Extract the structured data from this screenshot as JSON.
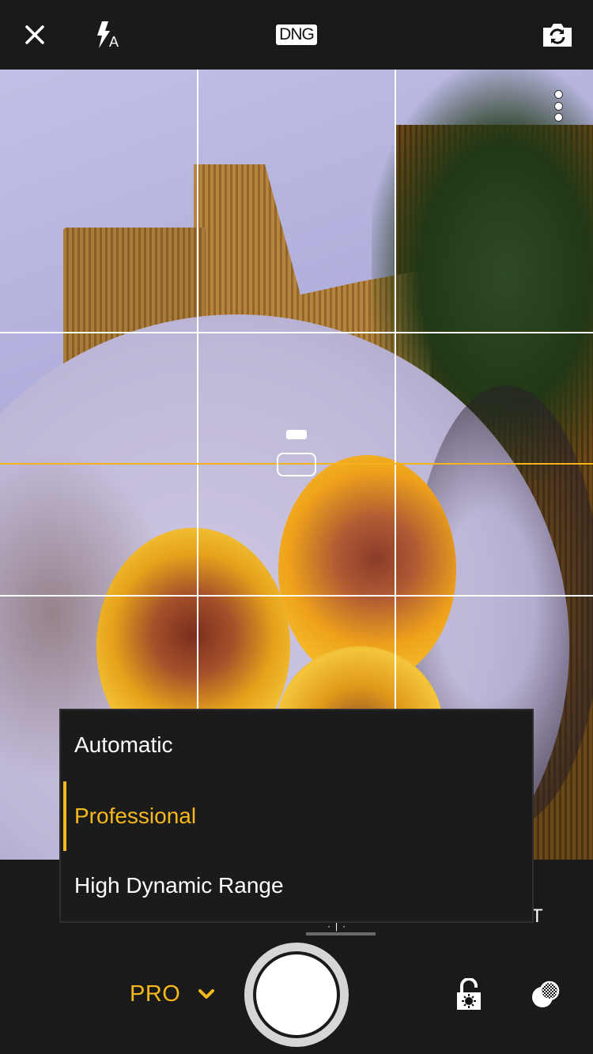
{
  "topbar": {
    "close_icon": "close-icon",
    "flash_icon": "flash-auto-icon",
    "flash_mode": "A",
    "format_badge": "DNG",
    "switch_camera_icon": "switch-camera-icon"
  },
  "viewfinder": {
    "more_icon": "more-vertical-icon",
    "grid": "rule-of-thirds",
    "horizon_color": "#f5b21b"
  },
  "capture_mode": {
    "current": "PRO",
    "dropdown_icon": "chevron-down-icon",
    "options": [
      {
        "label": "Automatic",
        "selected": false
      },
      {
        "label": "Professional",
        "selected": true
      },
      {
        "label": "High Dynamic Range",
        "selected": false
      }
    ]
  },
  "partial_labels": {
    "right_label_fragment": "T"
  },
  "bottom": {
    "shutter_icon": "shutter-button",
    "lock_icon": "exposure-lock-icon",
    "effects_icon": "effects-icon"
  },
  "colors": {
    "accent": "#f5b91b",
    "background": "#1a1a1a",
    "menu_bg": "#1b1b1b"
  }
}
